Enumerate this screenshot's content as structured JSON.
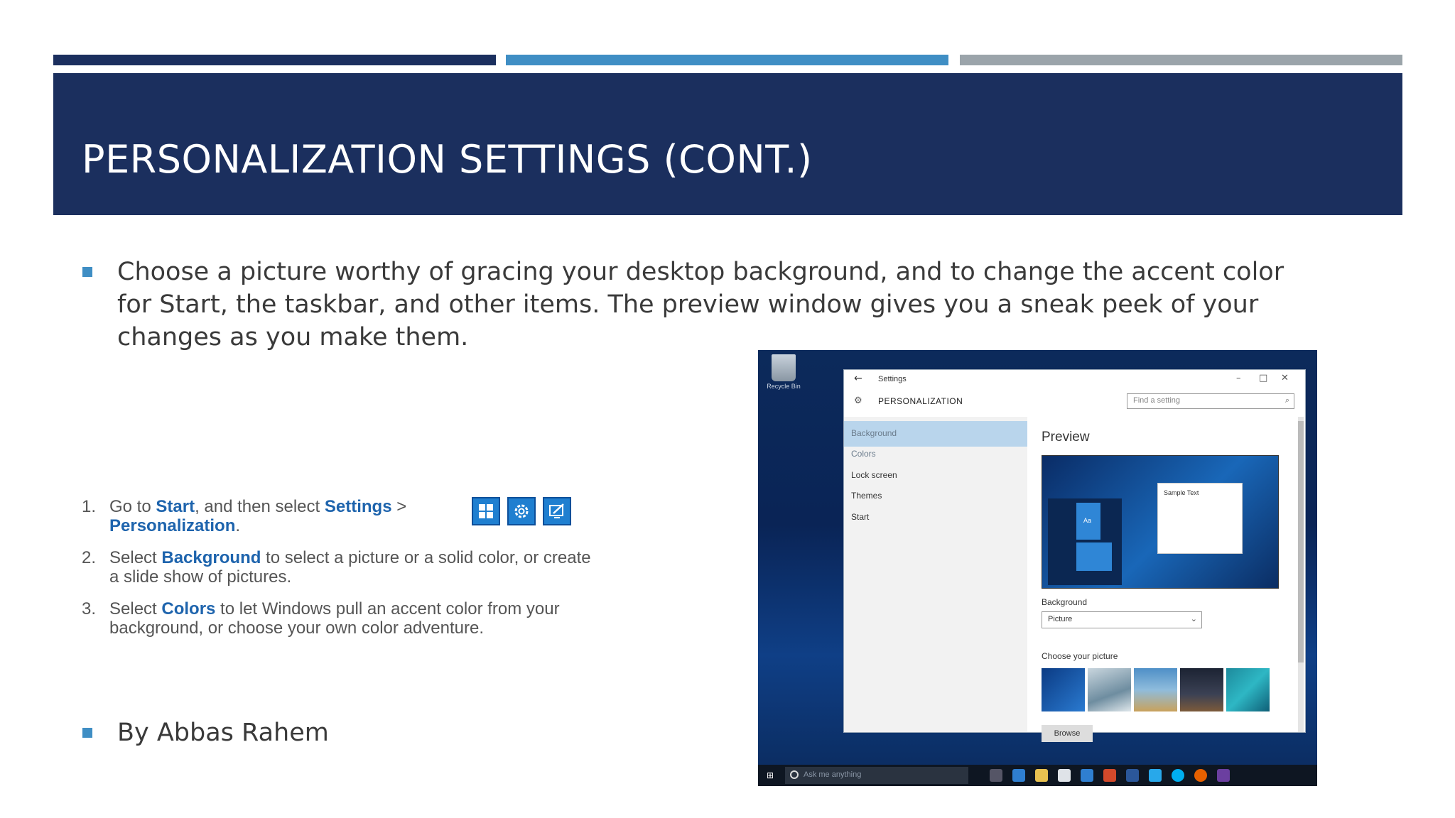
{
  "slide": {
    "title": "PERSONALIZATION SETTINGS (CONT.)",
    "bullet1": "Choose a picture worthy of gracing your desktop background, and to change the accent color for Start, the taskbar, and other items. The preview window gives you a sneak peek of your changes as you make them.",
    "bullet2": "By Abbas Rahem",
    "colors": {
      "header": "#1b2f5e",
      "accent_blue": "#3f8ec4",
      "accent_gray": "#9ba4aa",
      "link": "#1e64ad"
    }
  },
  "steps": [
    {
      "num": "1.",
      "pre": "Go to ",
      "k1": "Start",
      "mid": ", and then select ",
      "k2": "Settings",
      "post": " >",
      "k3": "Personalization",
      "end": "."
    },
    {
      "num": "2.",
      "pre": "Select ",
      "k1": "Background",
      "post": " to select a picture or a solid color, or create a slide show of pictures."
    },
    {
      "num": "3.",
      "pre": "Select ",
      "k1": "Colors",
      "post": " to let Windows pull an accent color from your background, or choose your own color adventure."
    }
  ],
  "step_icons": [
    "windows-logo-icon",
    "gear-icon",
    "personalize-icon"
  ],
  "screenshot": {
    "recycle_bin": "Recycle Bin",
    "window_title": "Settings",
    "section": "PERSONALIZATION",
    "find_placeholder": "Find a setting",
    "nav": [
      "Background",
      "Colors",
      "Lock screen",
      "Themes",
      "Start"
    ],
    "preview_heading": "Preview",
    "sample_text": "Sample Text",
    "tile_label": "Aa",
    "background_label": "Background",
    "background_value": "Picture",
    "choose_label": "Choose your picture",
    "browse": "Browse",
    "taskbar_search": "Ask me anything"
  }
}
